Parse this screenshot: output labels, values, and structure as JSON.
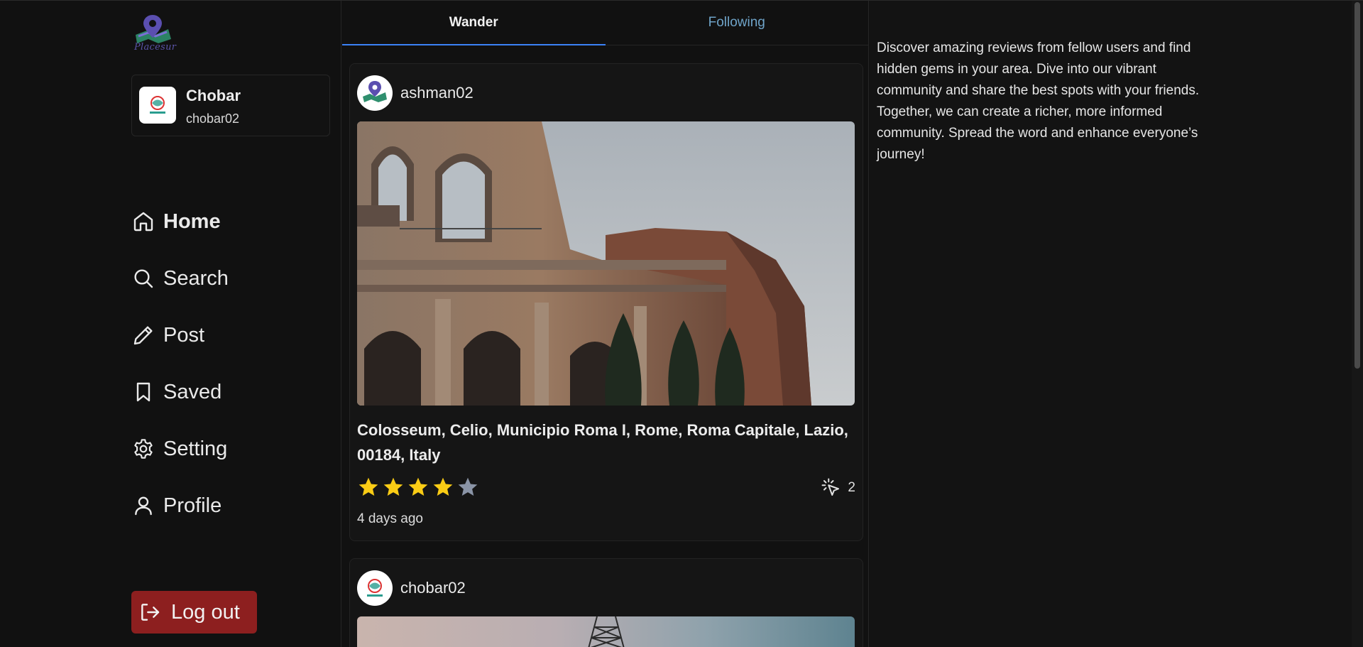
{
  "app": {
    "logo_text": "Placesur"
  },
  "user_card": {
    "name": "Chobar",
    "handle": "chobar02"
  },
  "nav": {
    "items": [
      {
        "label": "Home",
        "icon": "home-icon",
        "active": true
      },
      {
        "label": "Search",
        "icon": "search-icon"
      },
      {
        "label": "Post",
        "icon": "pencil-icon"
      },
      {
        "label": "Saved",
        "icon": "bookmark-icon"
      },
      {
        "label": "Setting",
        "icon": "gear-icon"
      },
      {
        "label": "Profile",
        "icon": "user-icon"
      }
    ],
    "logout_label": "Log out"
  },
  "tabs": [
    {
      "label": "Wander",
      "active": true
    },
    {
      "label": "Following",
      "active": false
    }
  ],
  "posts": [
    {
      "username": "ashman02",
      "location": "Colosseum, Celio, Municipio Roma I, Rome, Roma Capitale, Lazio, 00184, Italy",
      "rating": 4,
      "rating_max": 5,
      "views": "2",
      "time": "4 days ago"
    },
    {
      "username": "chobar02"
    }
  ],
  "right_panel": {
    "text": "Discover amazing reviews from fellow users and find hidden gems in your area. Dive into our vibrant community and share the best spots with your friends. Together, we can create a richer, more informed community. Spread the word and enhance everyone’s journey!"
  },
  "colors": {
    "accent": "#3b82f6",
    "logout": "#8d1f1f",
    "star_filled": "#facc15",
    "star_empty": "#8a94a6",
    "tab_inactive": "#6fa4c9"
  }
}
